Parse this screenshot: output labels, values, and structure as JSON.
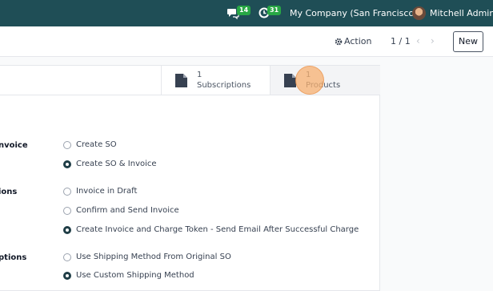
{
  "navbar": {
    "chat_icon": "chat-icon",
    "chat_count": "14",
    "activity_icon": "clock-icon",
    "activity_count": "31",
    "company": "My Company (San Francisco)",
    "user": "Mitchell Admin"
  },
  "control": {
    "action_label": "Action",
    "pager": "1 / 1",
    "new_label": "New"
  },
  "stat_buttons": [
    {
      "count": "1",
      "label": "Subscriptions",
      "icon": "document-icon"
    },
    {
      "count": "1",
      "label": "Products",
      "icon": "document-icon"
    }
  ],
  "fields": [
    {
      "label": "nvoice",
      "options": [
        {
          "label": "Create SO",
          "checked": false
        },
        {
          "label": "Create SO & Invoice",
          "checked": true
        }
      ]
    },
    {
      "label": "ions",
      "options": [
        {
          "label": "Invoice in Draft",
          "checked": false
        },
        {
          "label": "Confirm and Send Invoice",
          "checked": false
        },
        {
          "label": "Create Invoice and Charge Token - Send Email After Successful Charge",
          "checked": true
        }
      ]
    },
    {
      "label": "ptions",
      "options": [
        {
          "label": "Use Shipping Method From Original SO",
          "checked": false
        },
        {
          "label": "Use Custom Shipping Method",
          "checked": true
        }
      ]
    }
  ],
  "colors": {
    "navbar": "#1f4e56",
    "badge": "#28a745",
    "highlight": "#f7b070"
  }
}
